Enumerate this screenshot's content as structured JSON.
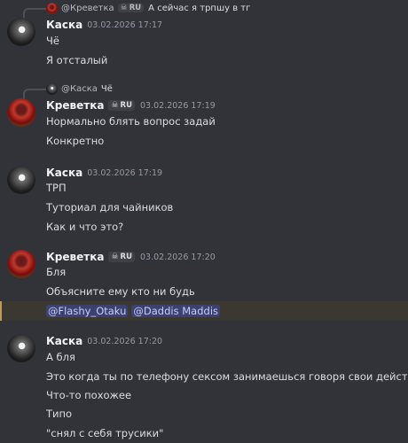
{
  "messages": [
    {
      "reply": {
        "name": "@Креветка",
        "badge": "RU",
        "text": "А сейчас я трпшу в тг"
      },
      "author": "Каска",
      "timestamp": "03.02.2026 17:17",
      "lines": [
        "Чё",
        "Я отсталый"
      ]
    },
    {
      "reply": {
        "name": "@Каска",
        "text": "Чё"
      },
      "author": "Креветка",
      "badge": "RU",
      "timestamp": "03.02.2026 17:19",
      "lines": [
        "Нормально блять вопрос задай",
        "Конкретно"
      ]
    },
    {
      "author": "Каска",
      "timestamp": "03.02.2026 17:19",
      "lines": [
        "ТРП",
        "Туториал для чайников",
        "Как и что это?"
      ]
    },
    {
      "author": "Креветка",
      "badge": "RU",
      "timestamp": "03.02.2026 17:20",
      "lines": [
        "Бля",
        "Объясните ему кто ни будь"
      ],
      "mentions": [
        "@Flashy_Otaku",
        "@Daddis Maddis"
      ]
    },
    {
      "author": "Каска",
      "timestamp": "03.02.2026 17:20",
      "lines": [
        "А бля",
        "Это когда ты по телефону сексом занимаешься говоря свои действия",
        "Что-то похожее",
        "Типо",
        "\"снял с себя трусики\""
      ]
    }
  ],
  "colors": {
    "background": "#323339",
    "mention_bg": "#3c4270",
    "highlight_bg": "#3b3731",
    "highlight_border": "#c29a57"
  },
  "icons": {
    "badge": "skull-icon"
  }
}
